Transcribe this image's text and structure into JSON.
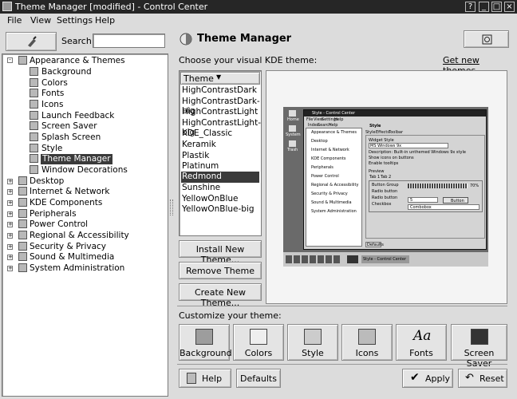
{
  "window": {
    "title": "Theme Manager [modified] - Control Center"
  },
  "menubar": {
    "items": [
      "File",
      "View",
      "Settings",
      "Help"
    ]
  },
  "search": {
    "label": "Search:",
    "value": ""
  },
  "header": {
    "title": "Theme Manager"
  },
  "main": {
    "choose_label": "Choose your visual KDE theme:",
    "get_new_link": "Get new themes...",
    "list_header": "Theme",
    "themes": [
      "HighContrastDark",
      "HighContrastDark-big",
      "HighContrastLight",
      "HighContrastLight-big",
      "KDE_Classic",
      "Keramik",
      "Plastik",
      "Platinum",
      "Redmond",
      "Sunshine",
      "YellowOnBlue",
      "YellowOnBlue-big"
    ],
    "selected_theme": "Redmond",
    "install_button": "Install New Theme...",
    "remove_button": "Remove Theme",
    "create_button": "Create New Theme...",
    "customize_label": "Customize your theme:",
    "customize_buttons": [
      "Background",
      "Colors",
      "Style",
      "Icons",
      "Fonts",
      "Screen Saver"
    ]
  },
  "bottom": {
    "help": "Help",
    "defaults": "Defaults",
    "apply": "Apply",
    "reset": "Reset"
  },
  "tree": {
    "root": "Appearance & Themes",
    "children": [
      "Background",
      "Colors",
      "Fonts",
      "Icons",
      "Launch Feedback",
      "Screen Saver",
      "Splash Screen",
      "Style",
      "Theme Manager",
      "Window Decorations"
    ],
    "sections": [
      "Desktop",
      "Internet & Network",
      "KDE Components",
      "Peripherals",
      "Power Control",
      "Regional & Accessibility",
      "Security & Privacy",
      "Sound & Multimedia",
      "System Administration"
    ]
  },
  "preview": {
    "desktop_icons": [
      "Home",
      "System",
      "Trash"
    ],
    "window_title": "Style - Control Center",
    "menus": [
      "File",
      "View",
      "Settings",
      "Help"
    ],
    "tabs": [
      "Index",
      "Search",
      "Help"
    ],
    "tree": [
      "Appearance & Themes",
      "Desktop",
      "Internet & Network",
      "KDE Components",
      "Peripherals",
      "Power Control",
      "Regional & Accessibility",
      "Security & Privacy",
      "Sound & Multimedia",
      "System Administration"
    ],
    "style_header": "Style",
    "style_tabs": [
      "Style",
      "Effects",
      "Toolbar"
    ],
    "widget_style_label": "Widget Style",
    "widget_style_value": "MS Windows 9x",
    "description": "Description: Built-in unthemed Windows 9x style",
    "check1": "Show icons on buttons",
    "check2": "Enable tooltips",
    "preview_label": "Preview",
    "tab1": "Tab 1",
    "tab2": "Tab 2",
    "button_group": "Button Group",
    "radio1": "Radio button",
    "radio2": "Radio button",
    "checkbox": "Checkbox",
    "progress": "70%",
    "spin": "5",
    "button": "Button",
    "combo": "Combobox",
    "defaults": "Defaults",
    "taskbar_item": "Style - Control Center"
  }
}
